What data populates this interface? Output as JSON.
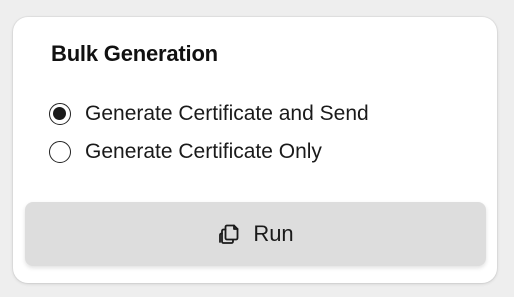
{
  "panel": {
    "title": "Bulk Generation"
  },
  "options": [
    {
      "label": "Generate Certificate and Send",
      "selected": true
    },
    {
      "label": "Generate Certificate Only",
      "selected": false
    }
  ],
  "run_button": {
    "label": "Run",
    "icon": "copy-files-icon"
  },
  "colors": {
    "card_background": "#ffffff",
    "page_background": "#eeeeee",
    "button_background": "#dddddd",
    "text": "#1a1a1a"
  }
}
